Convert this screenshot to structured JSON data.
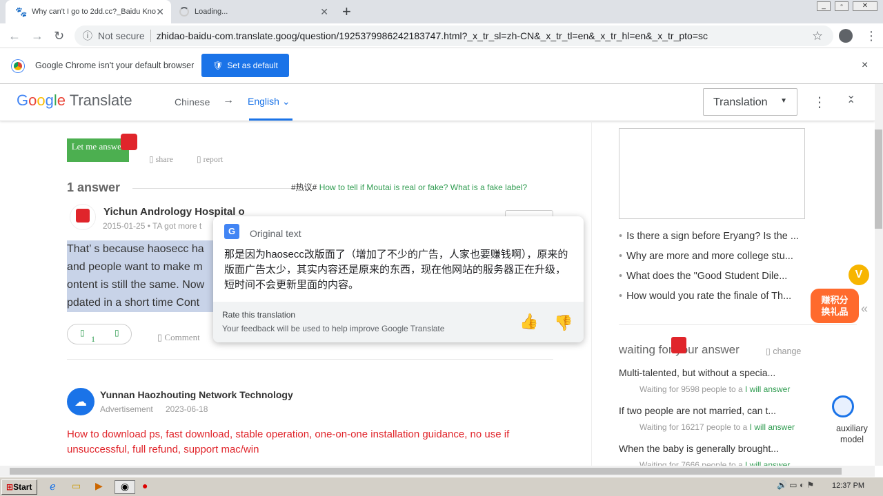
{
  "browser": {
    "tabs": [
      {
        "title": "Why can't I go to 2dd.cc?_Baidu Kno",
        "active": true
      },
      {
        "title": "Loading...",
        "active": false
      }
    ],
    "new_tab": "+",
    "omnibox": {
      "security": "Not secure",
      "url": "zhidao-baidu-com.translate.goog/question/1925379986242183747.html?_x_tr_sl=zh-CN&_x_tr_tl=en&_x_tr_hl=en&_x_tr_pto=sc"
    },
    "infobar": {
      "message": "Google Chrome isn't your default browser",
      "button": "Set as default",
      "close": "×"
    }
  },
  "translate_bar": {
    "logo": "Google Translate",
    "source_lang": "Chinese",
    "arrow": "→",
    "target_lang": "English",
    "mode": "Translation"
  },
  "page": {
    "answer_button": "Let me answer",
    "share": "share",
    "report": "report",
    "answer_count": "1 answer",
    "hot_tag": "#热议#",
    "hot_link": "How to tell if Moutai is real or fake? What is a fake label?",
    "answer": {
      "author": "Yichun Andrology Hospital o",
      "meta": "2015-01-25 • TA got more t",
      "lines": [
        "That’  s because haosecc ha",
        "and people want to make m",
        "ontent is still the same. Now",
        "pdated in a short time Cont"
      ],
      "likes": "1",
      "comment": "Comment"
    },
    "ad": {
      "author": "Yunnan Haozhouting Network Technology",
      "label": "Advertisement",
      "date": "2023-06-18",
      "text": "How to download ps, fast download, stable operation, one-on-one installation guidance, no use if unsuccessful, full refund, support mac/win"
    },
    "sidebar": {
      "related": [
        "Is there a sign before Eryang? Is the ...",
        "Why are more and more college stu...",
        "What does the \"Good Student Dile...",
        "How would you rate the finale of Th..."
      ],
      "badge": "赚积分\n换礼品",
      "waiting_title": "waiting for your answer",
      "change": "change",
      "questions": [
        {
          "q": "Multi-talented, but without a specia...",
          "meta": "Waiting for 9598  people to a",
          "action": "I will answer"
        },
        {
          "q": "If two people are not married, can t...",
          "meta": "Waiting for 16217  people to a",
          "action": "I will answer"
        },
        {
          "q": "When the baby is generally brought...",
          "meta": "Waiting for 7666  people to a",
          "action": "I will answer"
        }
      ],
      "aux": "auxiliary model"
    }
  },
  "popup": {
    "header": "Original text",
    "original": "那是因为haosecc改版面了（增加了不少的广告，人家也要赚钱啊），原来的版面广告太少，其实内容还是原来的东西，现在他网站的服务器正在升级，短时间不会更新里面的内容。",
    "rate": "Rate this translation",
    "feedback": "Your feedback will be used to help improve Google Translate"
  },
  "taskbar": {
    "start": "Start",
    "clock": "12:37 PM"
  }
}
